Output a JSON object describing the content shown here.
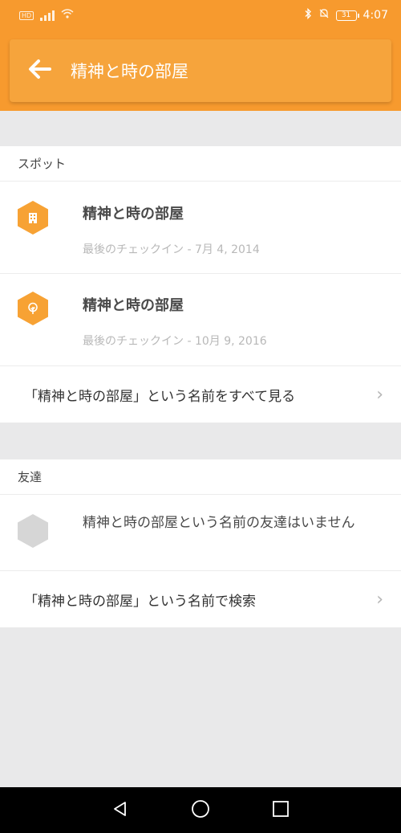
{
  "status_bar": {
    "hd": "HD",
    "battery": "31",
    "time": "4:07"
  },
  "toolbar": {
    "title": "精神と時の部屋"
  },
  "spots": {
    "header": "スポット",
    "items": [
      {
        "name": "精神と時の部屋",
        "subtitle": "最後のチェックイン - 7月 4, 2014",
        "icon": "building-icon"
      },
      {
        "name": "精神と時の部屋",
        "subtitle": "最後のチェックイン - 10月 9, 2016",
        "icon": "tree-icon"
      }
    ],
    "see_all": "「精神と時の部屋」という名前をすべて見る"
  },
  "friends": {
    "header": "友達",
    "empty_message": "精神と時の部屋という名前の友達はいません",
    "search": "「精神と時の部屋」という名前で検索"
  },
  "colors": {
    "brand": "#f79a2e",
    "toolbar": "#f6a43c",
    "background": "#e9e9ea"
  }
}
